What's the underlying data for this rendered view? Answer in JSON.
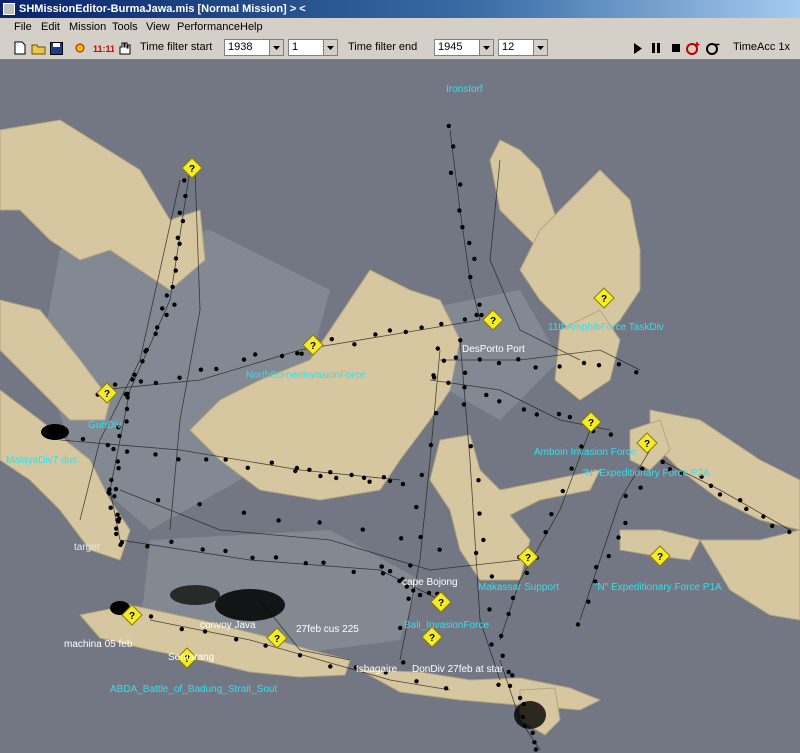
{
  "window": {
    "title": "SHMissionEditor-BurmaJawa.mis [Normal Mission]  > <"
  },
  "menu": [
    "File",
    "Edit",
    "Mission",
    "Tools",
    "View",
    "Performance",
    "Help"
  ],
  "toolbar": {
    "icons": [
      "new-file-icon",
      "open-folder-icon",
      "save-icon",
      "unit-icon",
      "time-icon",
      "hand-icon"
    ],
    "time_filter_start_label": "Time filter start",
    "start_year": "1938",
    "start_month": "1",
    "time_filter_end_label": "Time filter end",
    "end_year": "1945",
    "end_month": "12",
    "time_acc_label": "TimeAcc 1x"
  },
  "map": {
    "labels": [
      "Ironstorf",
      "NorthBorneoInvasionForce",
      "DesPorto Port",
      "11thAmphibForce TaskDiv",
      "GuhDiv",
      "MalayaDiv7 dus",
      "target",
      "Amboin Invasion Force",
      "\"N\" Expeditionary Force P2A",
      "\"N\" Expeditionary Force P1A",
      "Makassar Support",
      "cape Bojong",
      "convoy Java",
      "27feb cus 225",
      "ABDA_Battle_of_Badung_Strait_Sout",
      "Semarang",
      "tsbagaire",
      "DonDiv 27feb at star",
      "Bali_InvasionForce",
      "machina 05 feb"
    ]
  }
}
